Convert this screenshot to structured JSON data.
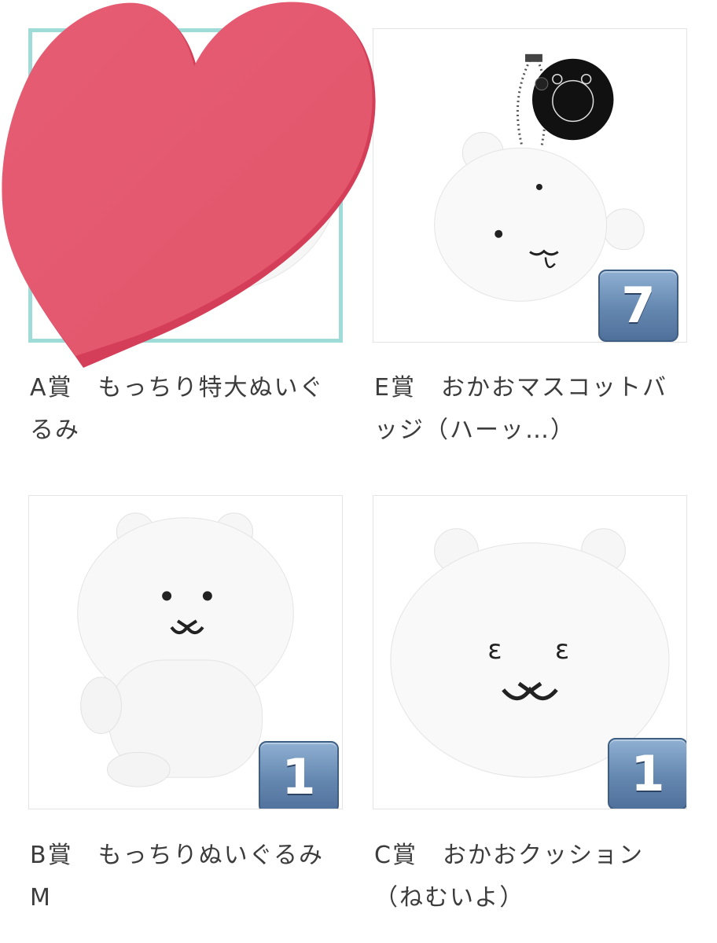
{
  "prizes": [
    {
      "title": "A賞　もっちり特大ぬいぐるみ",
      "count": ""
    },
    {
      "title": "E賞　おかおマスコットバッジ（ハーッ…）",
      "count": "7"
    },
    {
      "title": "B賞　もっちりぬいぐるみM",
      "count": "1"
    },
    {
      "title": "C賞　おかおクッション（ねむいよ）",
      "count": "1"
    }
  ],
  "colors": {
    "selected_border": "#9fdcd8",
    "heart": "#e85a70",
    "badge": "#6487b0"
  }
}
